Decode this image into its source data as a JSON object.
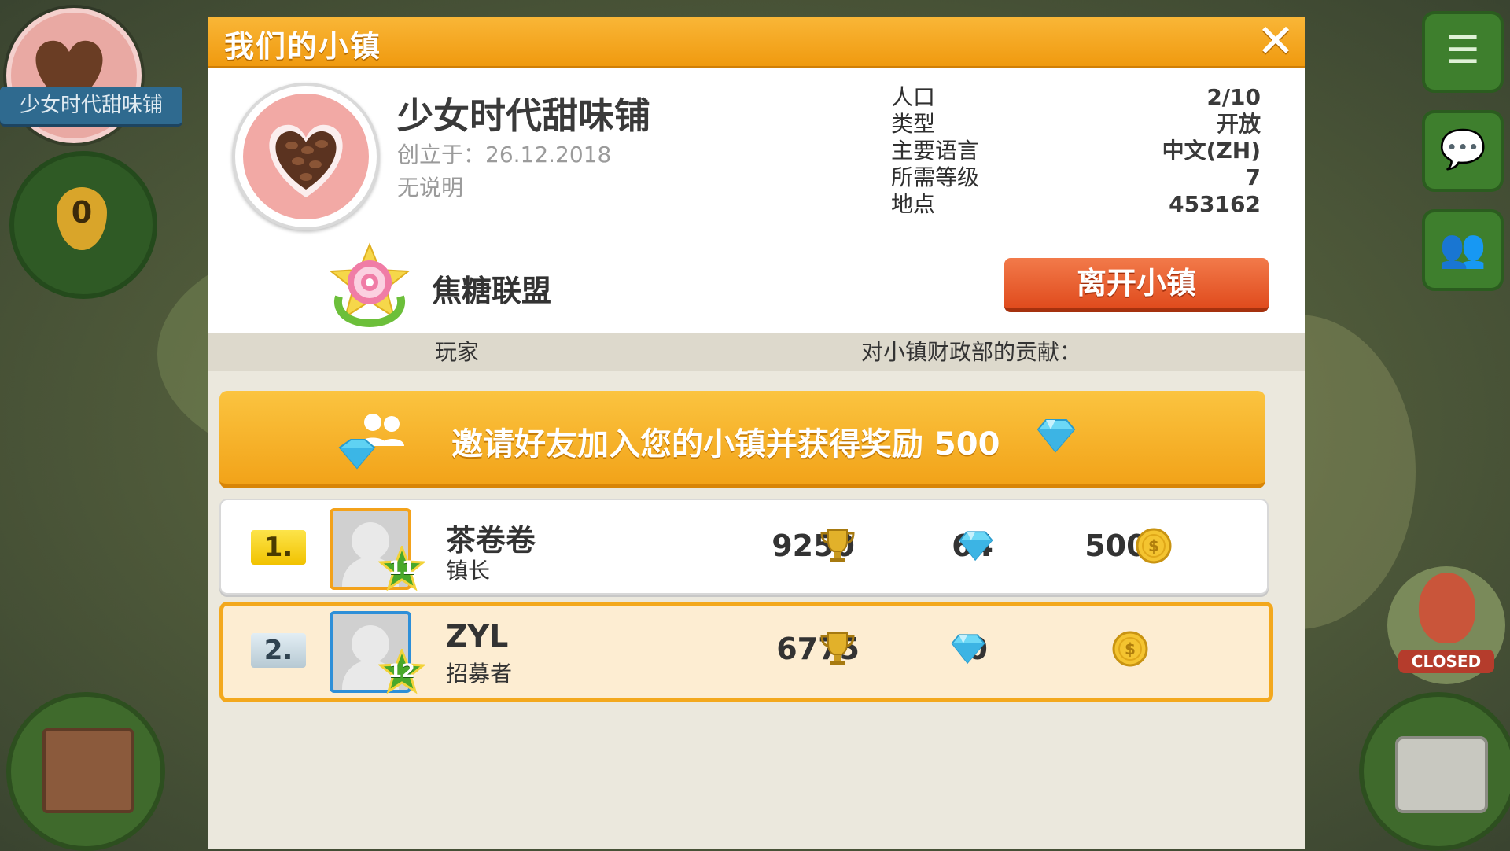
{
  "background": {
    "town_banner": "少女时代甜味铺",
    "trophy_count": "0",
    "closed_label": "CLOSED",
    "right_buttons": [
      "list-icon",
      "chat-icon",
      "friends-icon"
    ]
  },
  "dialog": {
    "title": "我们的小镇",
    "close_icon": "close-icon",
    "town": {
      "name": "少女时代甜味铺",
      "founded": "创立于：26.12.2018",
      "description": "无说明"
    },
    "stats": [
      {
        "label": "人口",
        "value": "2/10"
      },
      {
        "label": "类型",
        "value": "开放"
      },
      {
        "label": "主要语言",
        "value": "中文(ZH)"
      },
      {
        "label": "所需等级",
        "value": "7"
      },
      {
        "label": "地点",
        "value": "453162"
      }
    ],
    "league_name": "焦糖联盟",
    "leave_button": "离开小镇",
    "columns": {
      "player": "玩家",
      "contribution": "对小镇财政部的贡献："
    },
    "invite_text": "邀请好友加入您的小镇并获得奖励 500",
    "players": [
      {
        "rank": "1.",
        "level": "11",
        "name": "茶卷卷",
        "role": "镇长",
        "trophies": "9250",
        "gems": "64",
        "coins": "5000"
      },
      {
        "rank": "2.",
        "level": "12",
        "name": "ZYL",
        "role": "招募者",
        "trophies": "6775",
        "gems": "0",
        "coins": "0"
      }
    ]
  },
  "colors": {
    "title_orange": "#f5a623",
    "leave_red": "#e04b1d",
    "self_row_bg": "#fdedd2",
    "self_row_border": "#f3a81d"
  }
}
